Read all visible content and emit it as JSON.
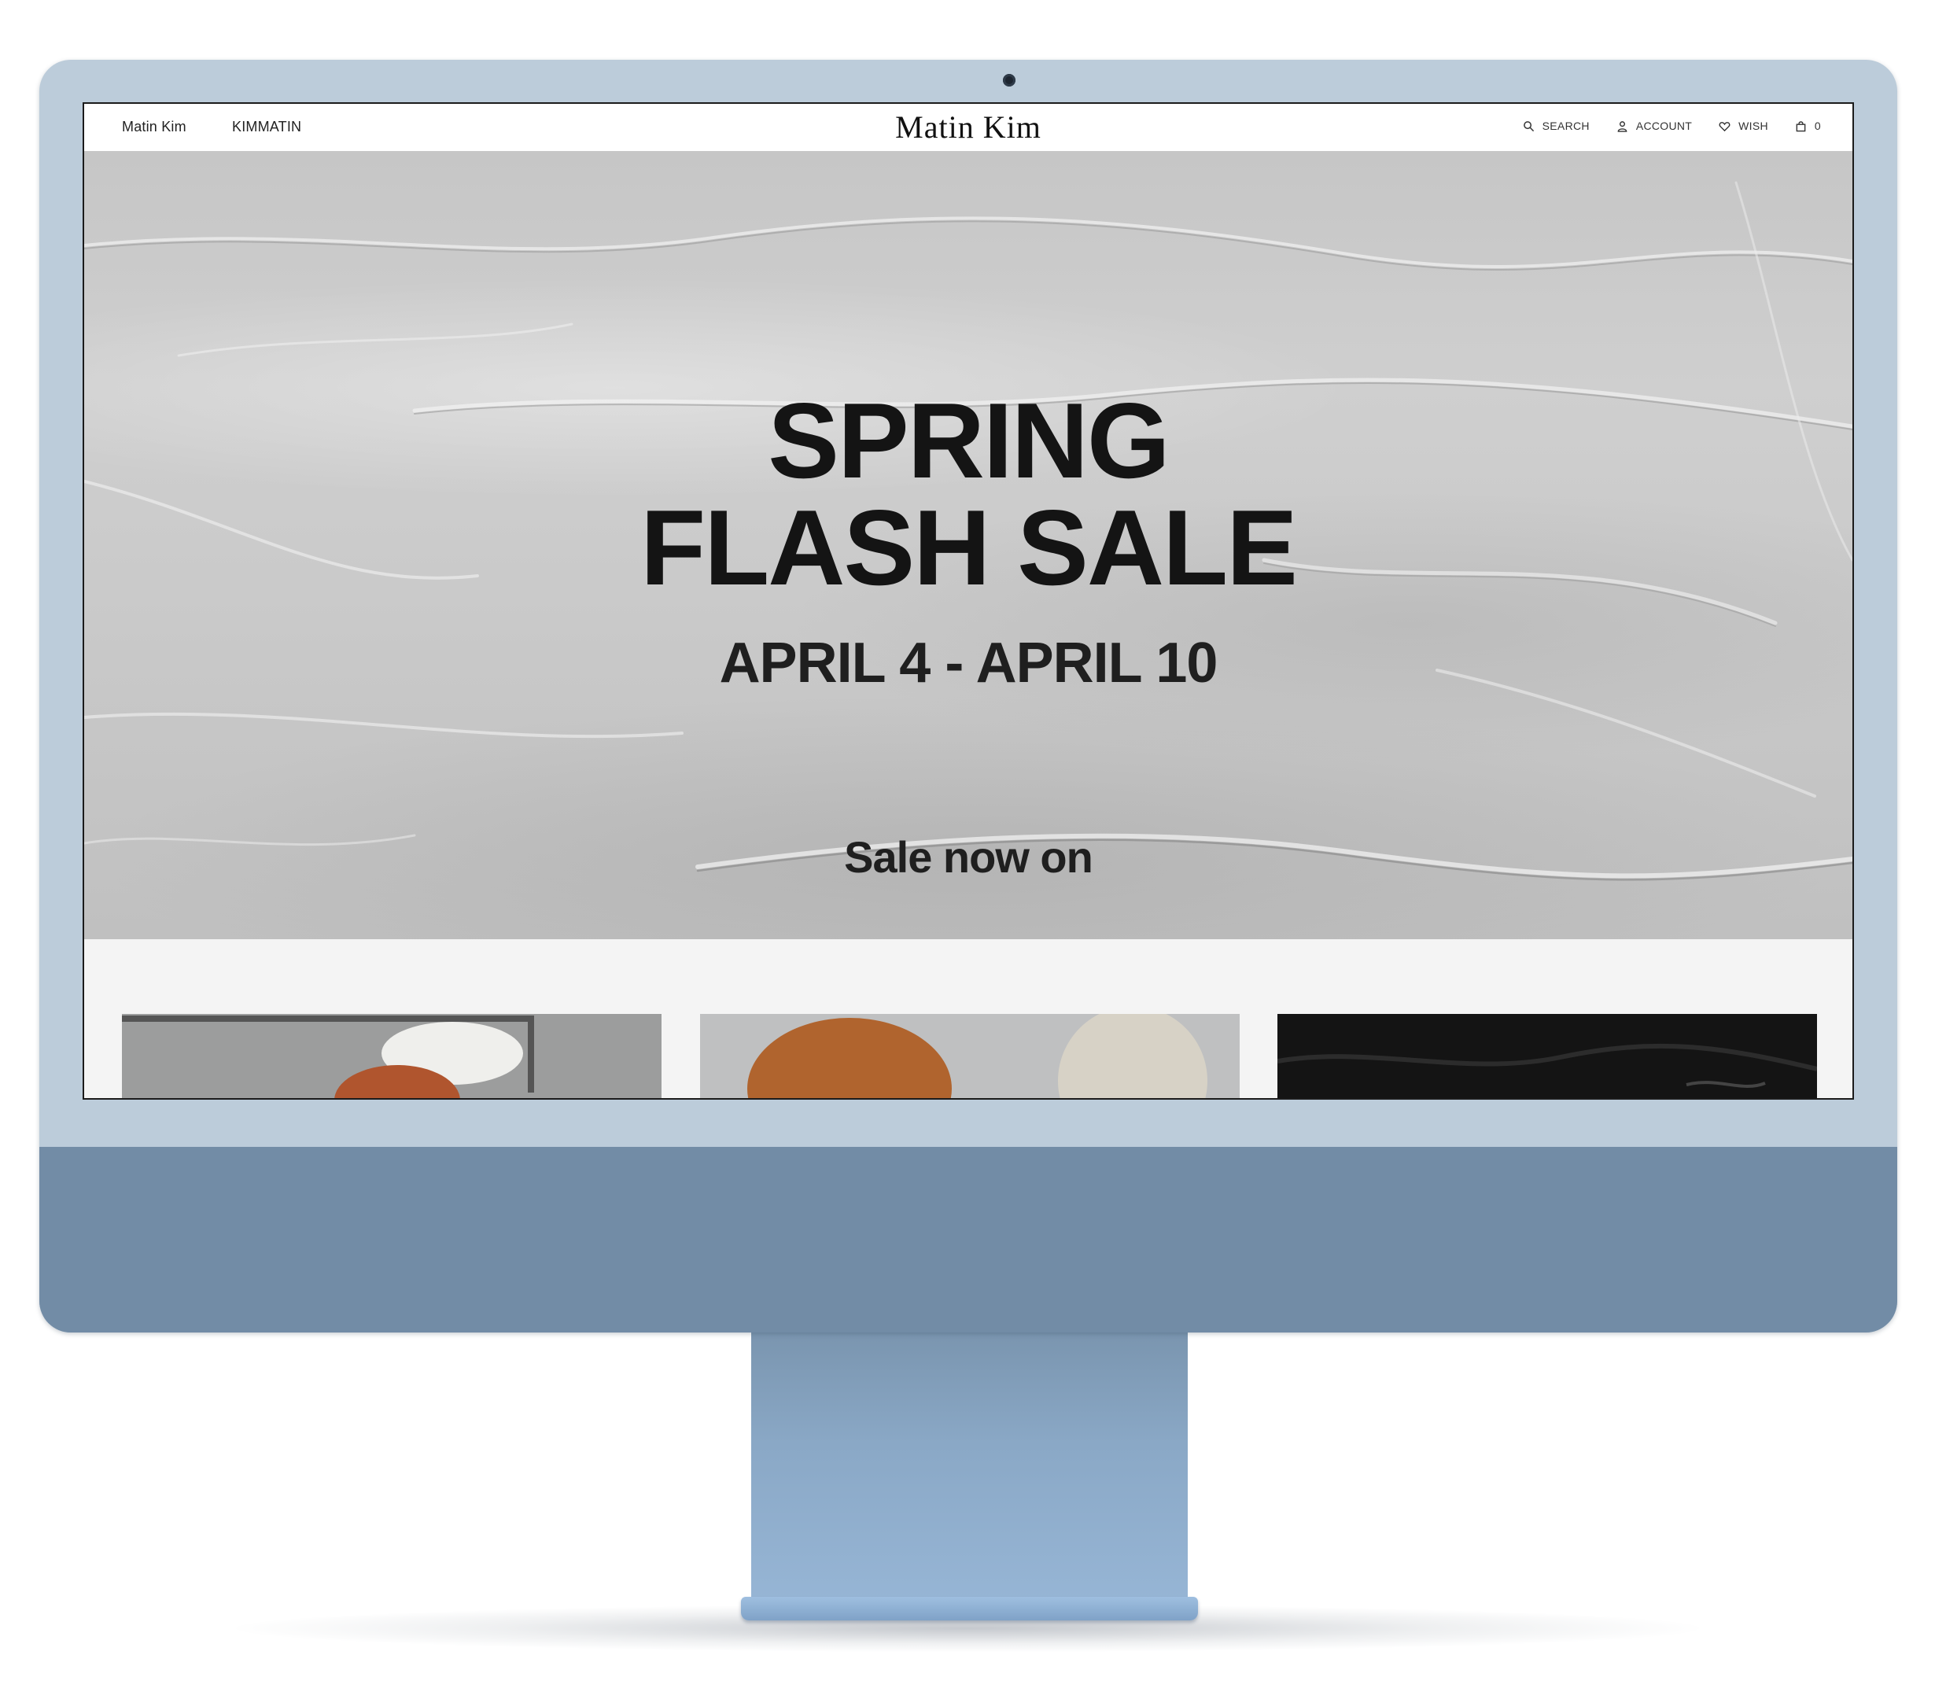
{
  "nav": {
    "left_links": [
      "Matin Kim",
      "KIMMATIN"
    ],
    "logo": "Matin Kim",
    "search_label": "SEARCH",
    "account_label": "ACCOUNT",
    "wish_label": "WISH",
    "cart_count": "0"
  },
  "hero": {
    "title_line1": "SPRING",
    "title_line2": "FLASH SALE",
    "dates": "APRIL 4 - APRIL 10",
    "cta": "Sale now on"
  },
  "icons": [
    "search-icon",
    "account-icon",
    "heart-icon",
    "bag-icon"
  ],
  "colors": {
    "device_frame": "#bcccda",
    "device_chin": "#728ca6",
    "hero_background": "#c9c9c9",
    "text": "#141414"
  }
}
